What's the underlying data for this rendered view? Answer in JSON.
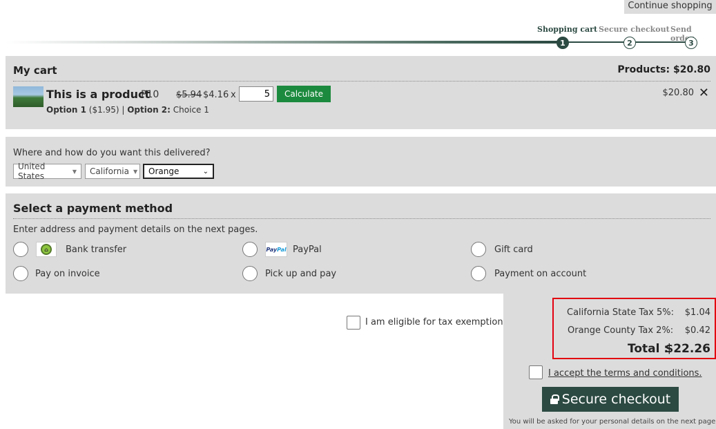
{
  "header": {
    "continue_label": "Continue shopping",
    "steps": [
      {
        "label": "Shopping cart",
        "number": "1"
      },
      {
        "label": "Secure checkout",
        "number": "2"
      },
      {
        "label": "Send order",
        "number": "3"
      }
    ]
  },
  "cart": {
    "title": "My cart",
    "products_total": "Products: $20.80",
    "item": {
      "name": "This is a product",
      "sku": "P10",
      "old_price": "$5.94",
      "new_price": "$4.16",
      "times": "x",
      "quantity": "5",
      "calculate_label": "Calculate",
      "option1_label": "Option 1",
      "option1_value": "($1.95) |",
      "option2_label": "Option 2:",
      "option2_value": "Choice 1",
      "line_total": "$20.80",
      "remove_icon": "close-icon"
    }
  },
  "delivery": {
    "question": "Where and how do you want this delivered?",
    "country": "United States",
    "state": "California",
    "county": "Orange"
  },
  "payment": {
    "title": "Select a payment method",
    "hint": "Enter address and payment details on the next pages.",
    "methods": [
      {
        "label": "Bank transfer"
      },
      {
        "label": "PayPal"
      },
      {
        "label": "Gift card"
      },
      {
        "label": "Pay on invoice"
      },
      {
        "label": "Pick up and pay"
      },
      {
        "label": "Payment on account"
      }
    ],
    "paypal_logo_a": "Pay",
    "paypal_logo_b": "Pal"
  },
  "summary": {
    "tax_exempt_label": "I am eligible for tax exemption",
    "state_tax_label": "California State Tax 5%:",
    "state_tax_value": "$1.04",
    "county_tax_label": "Orange County Tax 2%:",
    "county_tax_value": "$0.42",
    "total_label": "Total :",
    "total_value": "$22.26",
    "terms_label": "I accept the terms and conditions.",
    "checkout_label": "Secure checkout",
    "note": "You will be asked for your personal details on the next page"
  },
  "colors": {
    "accent": "#2c4a42",
    "calculate": "#1c8a3e",
    "highlight": "#e3000f",
    "panel": "#dcdcdc"
  }
}
